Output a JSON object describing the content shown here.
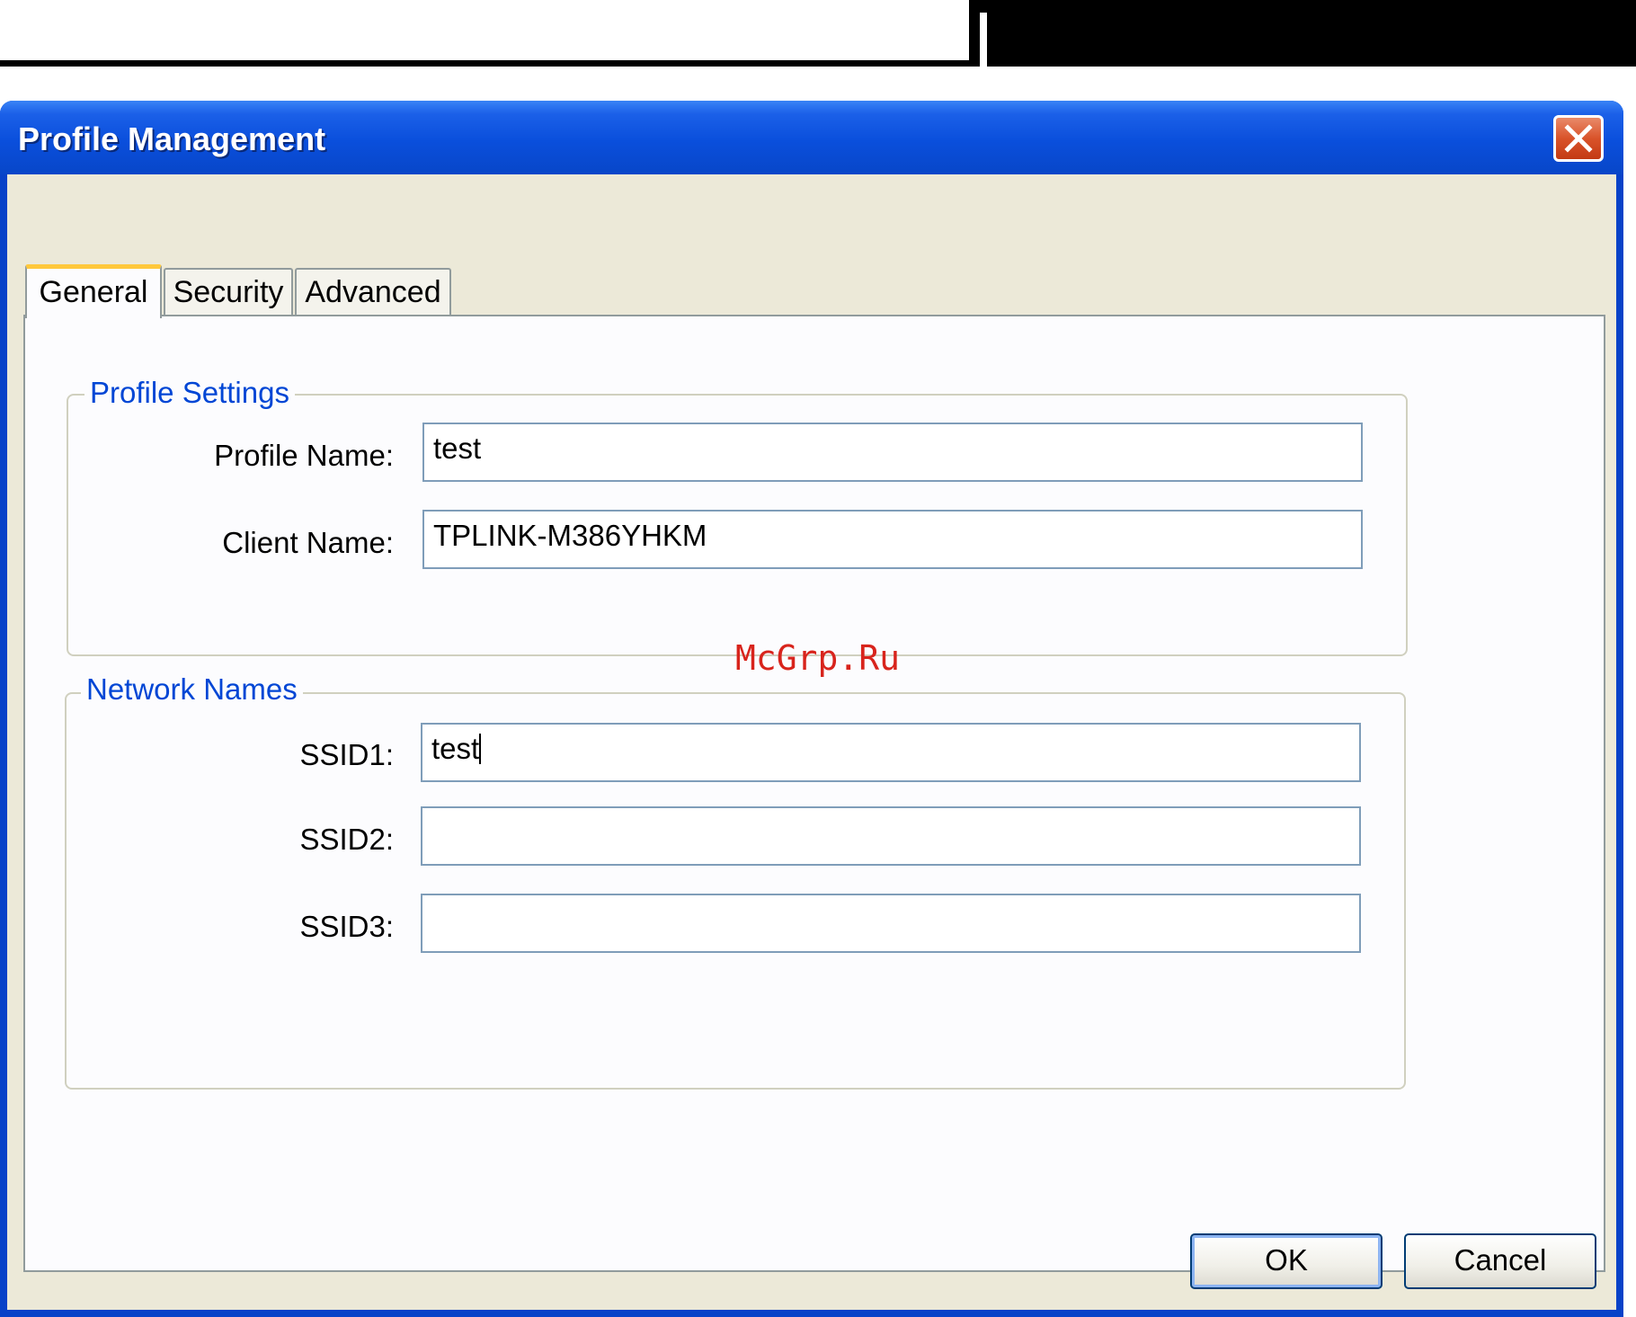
{
  "window": {
    "title": "Profile Management"
  },
  "tabs": [
    {
      "label": "General",
      "active": true
    },
    {
      "label": "Security",
      "active": false
    },
    {
      "label": "Advanced",
      "active": false
    }
  ],
  "profile_settings": {
    "legend": "Profile Settings",
    "profile_name_label": "Profile Name:",
    "profile_name_value": "test",
    "client_name_label": "Client Name:",
    "client_name_value": "TPLINK-M386YHKM"
  },
  "network_names": {
    "legend": "Network Names",
    "ssid1_label": "SSID1:",
    "ssid1_value": "test",
    "ssid2_label": "SSID2:",
    "ssid2_value": "",
    "ssid3_label": "SSID3:",
    "ssid3_value": ""
  },
  "buttons": {
    "ok": "OK",
    "cancel": "Cancel"
  },
  "watermark": "McGrp.Ru",
  "colors": {
    "titlebar": "#0a4fdc",
    "legend": "#0046d5",
    "face": "#ece9d8",
    "watermark": "#d8241c"
  }
}
